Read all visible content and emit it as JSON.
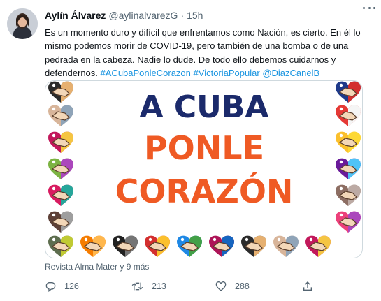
{
  "author": {
    "display_name": "Aylín Álvarez",
    "handle": "@aylinalvarezG",
    "separator": "·",
    "time": "15h"
  },
  "tweet": {
    "text": "Es un momento duro y difícil que enfrentamos como Nación, es cierto. En él lo mismo podemos morir de COVID-19, pero también de una bomba o de una pedrada en la cabeza. Nadie lo dude. De todo ello debemos cuidarnos y defendernos.",
    "hashtags": [
      "#ACubaPonleCorazon",
      "#VictoriaPopular"
    ],
    "mention": "@DiazCanelB"
  },
  "media": {
    "headline": "A CUBA",
    "line2": "PONLE",
    "line3": "CORAZÓN",
    "headline_color": "#1b2a6b",
    "accent_color": "#ef5a24"
  },
  "caption": "Revista Alma Mater y 9 más",
  "actions": {
    "reply_count": "126",
    "retweet_count": "213",
    "like_count": "288"
  },
  "icons": {
    "avatar": "profile-photo",
    "more": "more-dots-icon",
    "reply": "reply-icon",
    "retweet": "retweet-icon",
    "like": "like-icon",
    "share": "share-icon"
  },
  "colors": {
    "link": "#1b95e0",
    "muted": "#536471"
  }
}
